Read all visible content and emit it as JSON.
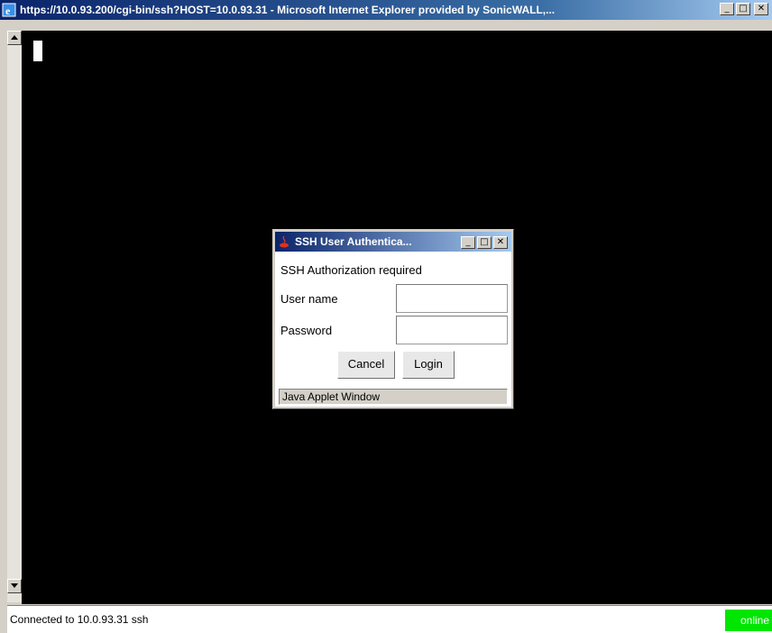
{
  "window": {
    "title": "https://10.0.93.200/cgi-bin/ssh?HOST=10.0.93.31 - Microsoft Internet Explorer provided by SonicWALL,...",
    "minimize_label": "_",
    "maximize_label": "□",
    "close_label": "✕"
  },
  "dialog": {
    "title": "SSH User Authentica...",
    "heading": "SSH Authorization required",
    "username_label": "User name",
    "username_value": "",
    "password_label": "Password",
    "password_value": "",
    "cancel_label": "Cancel",
    "login_label": "Login",
    "applet_notice": "Java Applet Window",
    "minimize_label": "_",
    "maximize_label": "□",
    "close_label": "✕"
  },
  "status": {
    "text": "Connected to 10.0.93.31 ssh",
    "connection": "online",
    "connection_color": "#00e600"
  },
  "colors": {
    "terminal_bg": "#000000",
    "titlebar_start": "#0a246a",
    "titlebar_end": "#a6caf0"
  }
}
